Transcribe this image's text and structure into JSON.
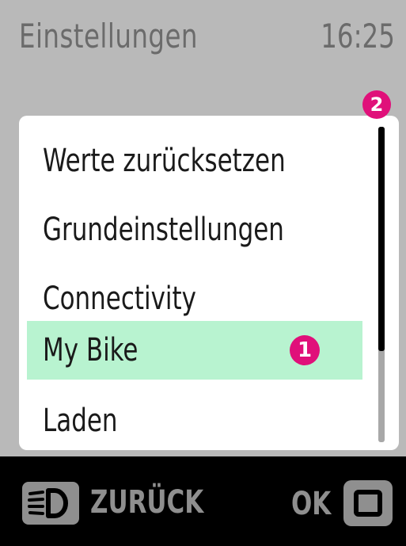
{
  "header": {
    "title": "Einstellungen",
    "time": "16:25"
  },
  "menu": {
    "items": [
      {
        "label": "Werte zurücksetzen"
      },
      {
        "label": "Grundeinstellungen"
      },
      {
        "label": "Connectivity"
      },
      {
        "label": "My Bike",
        "selected": true
      },
      {
        "label": "Laden"
      }
    ],
    "selected_badge": "1",
    "scroll_badge": "2"
  },
  "scrollbar": {
    "visible_fraction": 0.71
  },
  "footer": {
    "back_label": "ZURÜCK",
    "ok_label": "OK",
    "back_icon": "light-icon",
    "ok_icon": "square-button-icon"
  },
  "colors": {
    "background": "#b9b9b9",
    "selected_row": "#b8f3d0",
    "badge": "#e0107a",
    "footer": "#000000"
  }
}
